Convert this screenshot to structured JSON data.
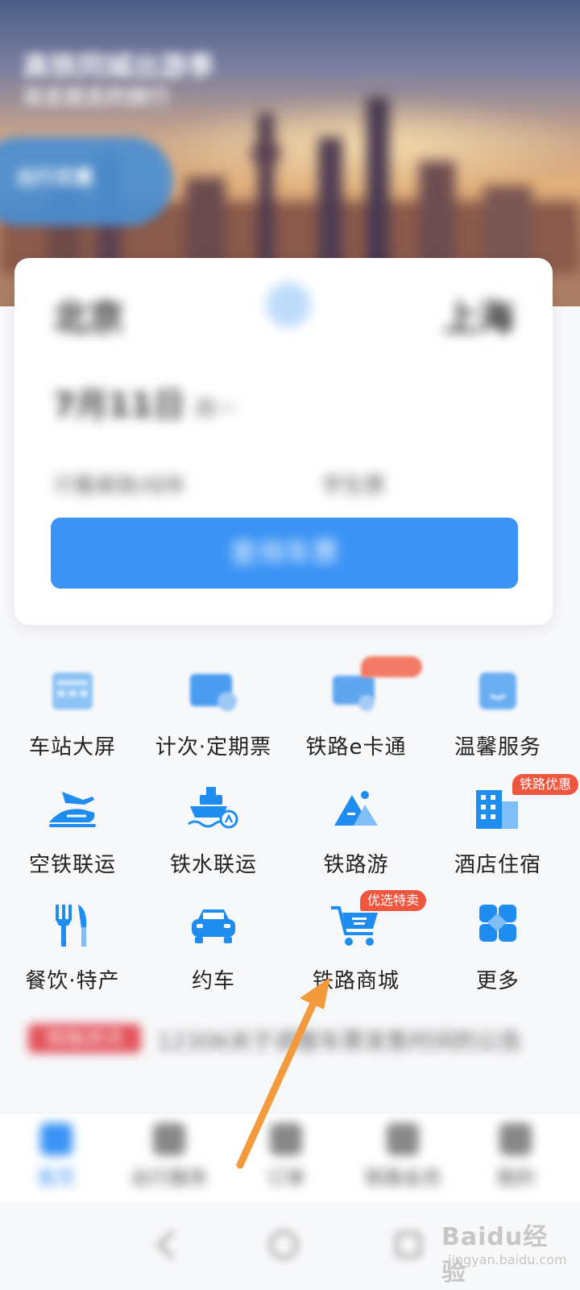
{
  "hero": {
    "headline": "高铁同城出游季",
    "subline": "说走就走的旅行",
    "promo": "出行优惠"
  },
  "search": {
    "from_city": "北京",
    "to_city": "上海",
    "date": "7月11日",
    "weekday": "周一",
    "option_left": "只看高铁/动车",
    "option_right": "学生票",
    "query_label": "查询车票"
  },
  "services": [
    {
      "label": "车站大屏",
      "icon": "station-screen-icon"
    },
    {
      "label": "计次·定期票",
      "icon": "ticket-pass-icon"
    },
    {
      "label": "铁路e卡通",
      "icon": "e-card-icon"
    },
    {
      "label": "温馨服务",
      "icon": "service-icon"
    },
    {
      "label": "空铁联运",
      "icon": "air-rail-icon"
    },
    {
      "label": "铁水联运",
      "icon": "ship-rail-icon"
    },
    {
      "label": "铁路游",
      "icon": "mountain-travel-icon"
    },
    {
      "label": "酒店住宿",
      "icon": "hotel-icon",
      "badge": "铁路优惠"
    },
    {
      "label": "餐饮·特产",
      "icon": "fork-knife-icon"
    },
    {
      "label": "约车",
      "icon": "car-icon"
    },
    {
      "label": "铁路商城",
      "icon": "shopping-cart-icon",
      "badge": "优选特卖"
    },
    {
      "label": "更多",
      "icon": "more-grid-icon"
    }
  ],
  "ticker": {
    "tag": "铁路资讯",
    "text": "12306关于调整车票发售时间的公告"
  },
  "tabs": [
    {
      "label": "首页"
    },
    {
      "label": "出行服务"
    },
    {
      "label": "订单"
    },
    {
      "label": "铁路会员"
    },
    {
      "label": "我的"
    }
  ],
  "watermark": {
    "main": "Baidu经验",
    "sub": "jingyan.baidu.com"
  },
  "colors": {
    "accent": "#3a93f5",
    "icon_blue": "#1f8cf0",
    "badge": "#f0553e",
    "arrow": "#f39a3c"
  }
}
